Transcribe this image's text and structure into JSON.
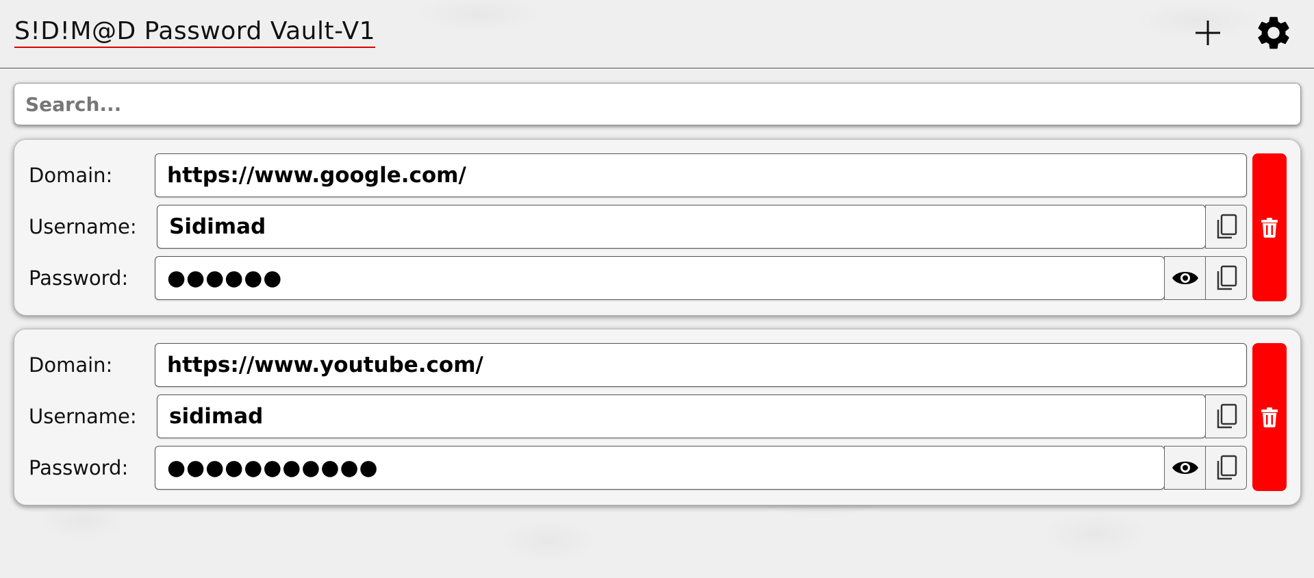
{
  "app": {
    "title": "S!D!M@D Password Vault-V1"
  },
  "header": {
    "add_icon": "plus-icon",
    "settings_icon": "gear-icon"
  },
  "search": {
    "placeholder": "Search...",
    "value": ""
  },
  "labels": {
    "domain": "Domain:",
    "username": "Username:",
    "password": "Password:"
  },
  "entries": [
    {
      "domain": "https://www.google.com/",
      "username": "Sidimad",
      "password_masked": "●●●●●●"
    },
    {
      "domain": "https://www.youtube.com/",
      "username": "sidimad",
      "password_masked": "●●●●●●●●●●●"
    }
  ],
  "colors": {
    "delete": "#ff0000",
    "title_underline": "#dd0000"
  }
}
